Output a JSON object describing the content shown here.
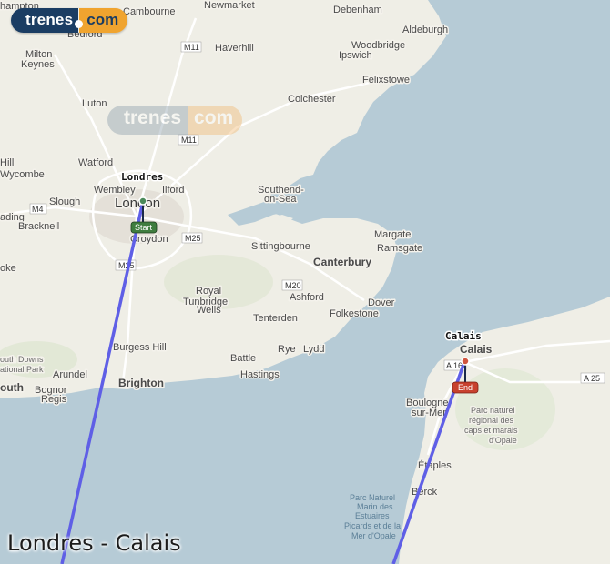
{
  "logo": {
    "left": "trenes",
    "right": "com"
  },
  "watermark": {
    "left": "trenes",
    "right": "com"
  },
  "route_title": "Londres - Calais",
  "origin_label": "Londres",
  "destination_label": "Calais",
  "start_marker": "Start",
  "end_marker": "End",
  "colors": {
    "route": "#5f5fe6",
    "land": "#efeee6",
    "sea": "#b6cbd6",
    "start": "#3f7d3f",
    "end": "#c8412e"
  },
  "places": {
    "cambourne": "Cambourne",
    "newmarket": "Newmarket",
    "debenham": "Debenham",
    "aldeburgh": "Aldeburgh",
    "bedford": "Bedford",
    "haverhill": "Haverhill",
    "woodbridge": "Woodbridge",
    "ipswich": "Ipswich",
    "milton_keynes_1": "Milton",
    "milton_keynes_2": "Keynes",
    "felixstowe": "Felixstowe",
    "luton": "Luton",
    "colchester": "Colchester",
    "hampton": "hampton",
    "watford": "Watford",
    "hill": "Hill",
    "wycombe": "Wycombe",
    "wembley": "Wembley",
    "ilford": "Ilford",
    "southend_1": "Southend-",
    "southend_2": "on-Sea",
    "slough": "Slough",
    "london": "London",
    "ading": "ading",
    "bracknell": "Bracknell",
    "croydon": "Croydon",
    "margate": "Margate",
    "ramsgate": "Ramsgate",
    "sittingbourne": "Sittingbourne",
    "canterbury": "Canterbury",
    "oke": "oke",
    "ashford": "Ashford",
    "dover": "Dover",
    "royal": "Royal",
    "tunbridge": "Tunbridge",
    "wells": "Wells",
    "tenterden": "Tenterden",
    "folkestone": "Folkestone",
    "burgess_hill": "Burgess Hill",
    "rye": "Rye",
    "lydd": "Lydd",
    "south_downs_1": "outh Downs",
    "south_downs_2": "ational Park",
    "arundel": "Arundel",
    "battle": "Battle",
    "hastings": "Hastings",
    "outh": "outh",
    "bognor_1": "Bognor",
    "bognor_2": "Regis",
    "brighton": "Brighton",
    "calais": "Calais",
    "boulogne_1": "Boulogne-",
    "boulogne_2": "sur-Mer",
    "parc_opale_1": "Parc naturel",
    "parc_opale_2": "régional des",
    "parc_opale_3": "caps et marais",
    "parc_opale_4": "d'Opale",
    "etaples": "Étaples",
    "berck": "Berck",
    "parc_marin_1": "Parc Naturel",
    "parc_marin_2": "Marin des",
    "parc_marin_3": "Estuaires",
    "parc_marin_4": "Picards et de la",
    "parc_marin_5": "Mer d'Opale"
  },
  "roads": {
    "m11a": "M11",
    "m11b": "M11",
    "m4": "M4",
    "m25a": "M25",
    "m25b": "M25",
    "m20": "M20",
    "a16": "A 16",
    "a25": "A 25"
  }
}
